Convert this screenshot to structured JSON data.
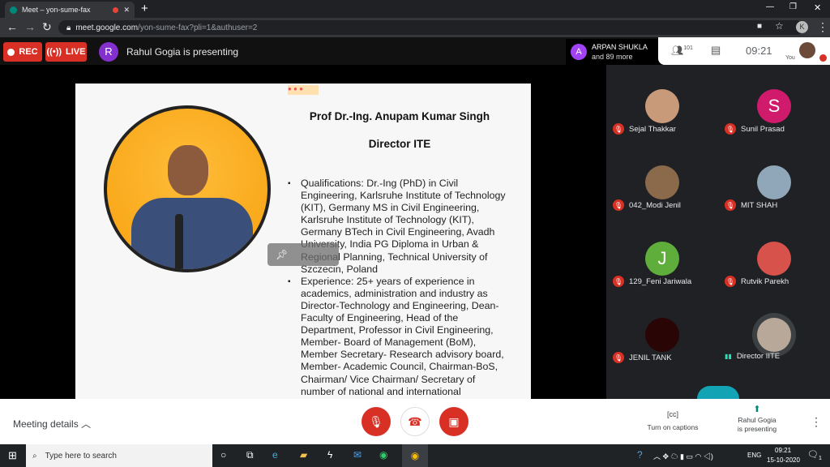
{
  "browser": {
    "tab_title": "Meet – yon-sume-fax",
    "url_host": "meet.google.com",
    "url_path": "/yon-sume-fax?pli=1&authuser=2",
    "profile_initial": "K"
  },
  "meet": {
    "rec_label": "REC",
    "live_label": "LIVE",
    "presenter_initial": "R",
    "presenter_text": "Rahul Gogia is presenting",
    "others_initial": "A",
    "others_name": "ARPAN SHUKLA",
    "others_more": "and 89 more",
    "participant_count": "101",
    "time": "09:21",
    "you_label": "You"
  },
  "slide": {
    "title": "Prof Dr.-Ing. Anupam Kumar Singh",
    "subtitle": "Director ITE",
    "bullets": [
      [
        "Qualifications: Dr.-Ing (PhD) in Civil",
        "Engineering, Karlsruhe Institute of Technology",
        "(KIT), Germany MS in Civil Engineering,",
        "Karlsruhe Institute of Technology (KIT),",
        "Germany BTech in Civil Engineering, Avadh",
        "University, India PG Diploma in Urban &",
        "Regional Planning, Technical University of",
        "Szczecin, Poland"
      ],
      [
        "Experience: 25+ years of experience in",
        "academics, administration and industry as",
        "Director-Technology and Engineering, Dean-",
        "Faculty of Engineering, Head of the",
        "Department, Professor in Civil Engineering,",
        "Member- Board of Management (BoM),",
        "Member Secretary- Research advisory board,",
        "Member- Academic Council, Chairman-BoS,",
        "Chairman/ Vice Chairman/ Secretary of",
        "number of national and international"
      ]
    ]
  },
  "participants": [
    {
      "name": "Sejal Thakkar",
      "initial": "",
      "color": "#c99a7a",
      "muted": true
    },
    {
      "name": "Sunil Prasad",
      "initial": "S",
      "color": "#d01a6b",
      "muted": true
    },
    {
      "name": "042_Modi Jenil",
      "initial": "",
      "color": "#8a6a4a",
      "muted": true
    },
    {
      "name": "MIT SHAH",
      "initial": "",
      "color": "#8fa7b8",
      "muted": true
    },
    {
      "name": "129_Feni Jariwala",
      "initial": "J",
      "color": "#5fae3c",
      "muted": true
    },
    {
      "name": "Rutvik Parekh",
      "initial": "",
      "color": "#d8524c",
      "muted": true
    },
    {
      "name": "JENIL TANK",
      "initial": "",
      "color": "#2a0505",
      "muted": true
    },
    {
      "name": "Director IITE",
      "initial": "",
      "color": "#b8a89a",
      "muted": false
    }
  ],
  "bottom": {
    "meeting_details": "Meeting details",
    "captions": "Turn on captions",
    "presenting_line1": "Rahul Gogia",
    "presenting_line2": "is presenting"
  },
  "taskbar": {
    "search_placeholder": "Type here to search",
    "lang": "ENG",
    "time": "09:21",
    "date": "15-10-2020",
    "notif_count": "1"
  }
}
